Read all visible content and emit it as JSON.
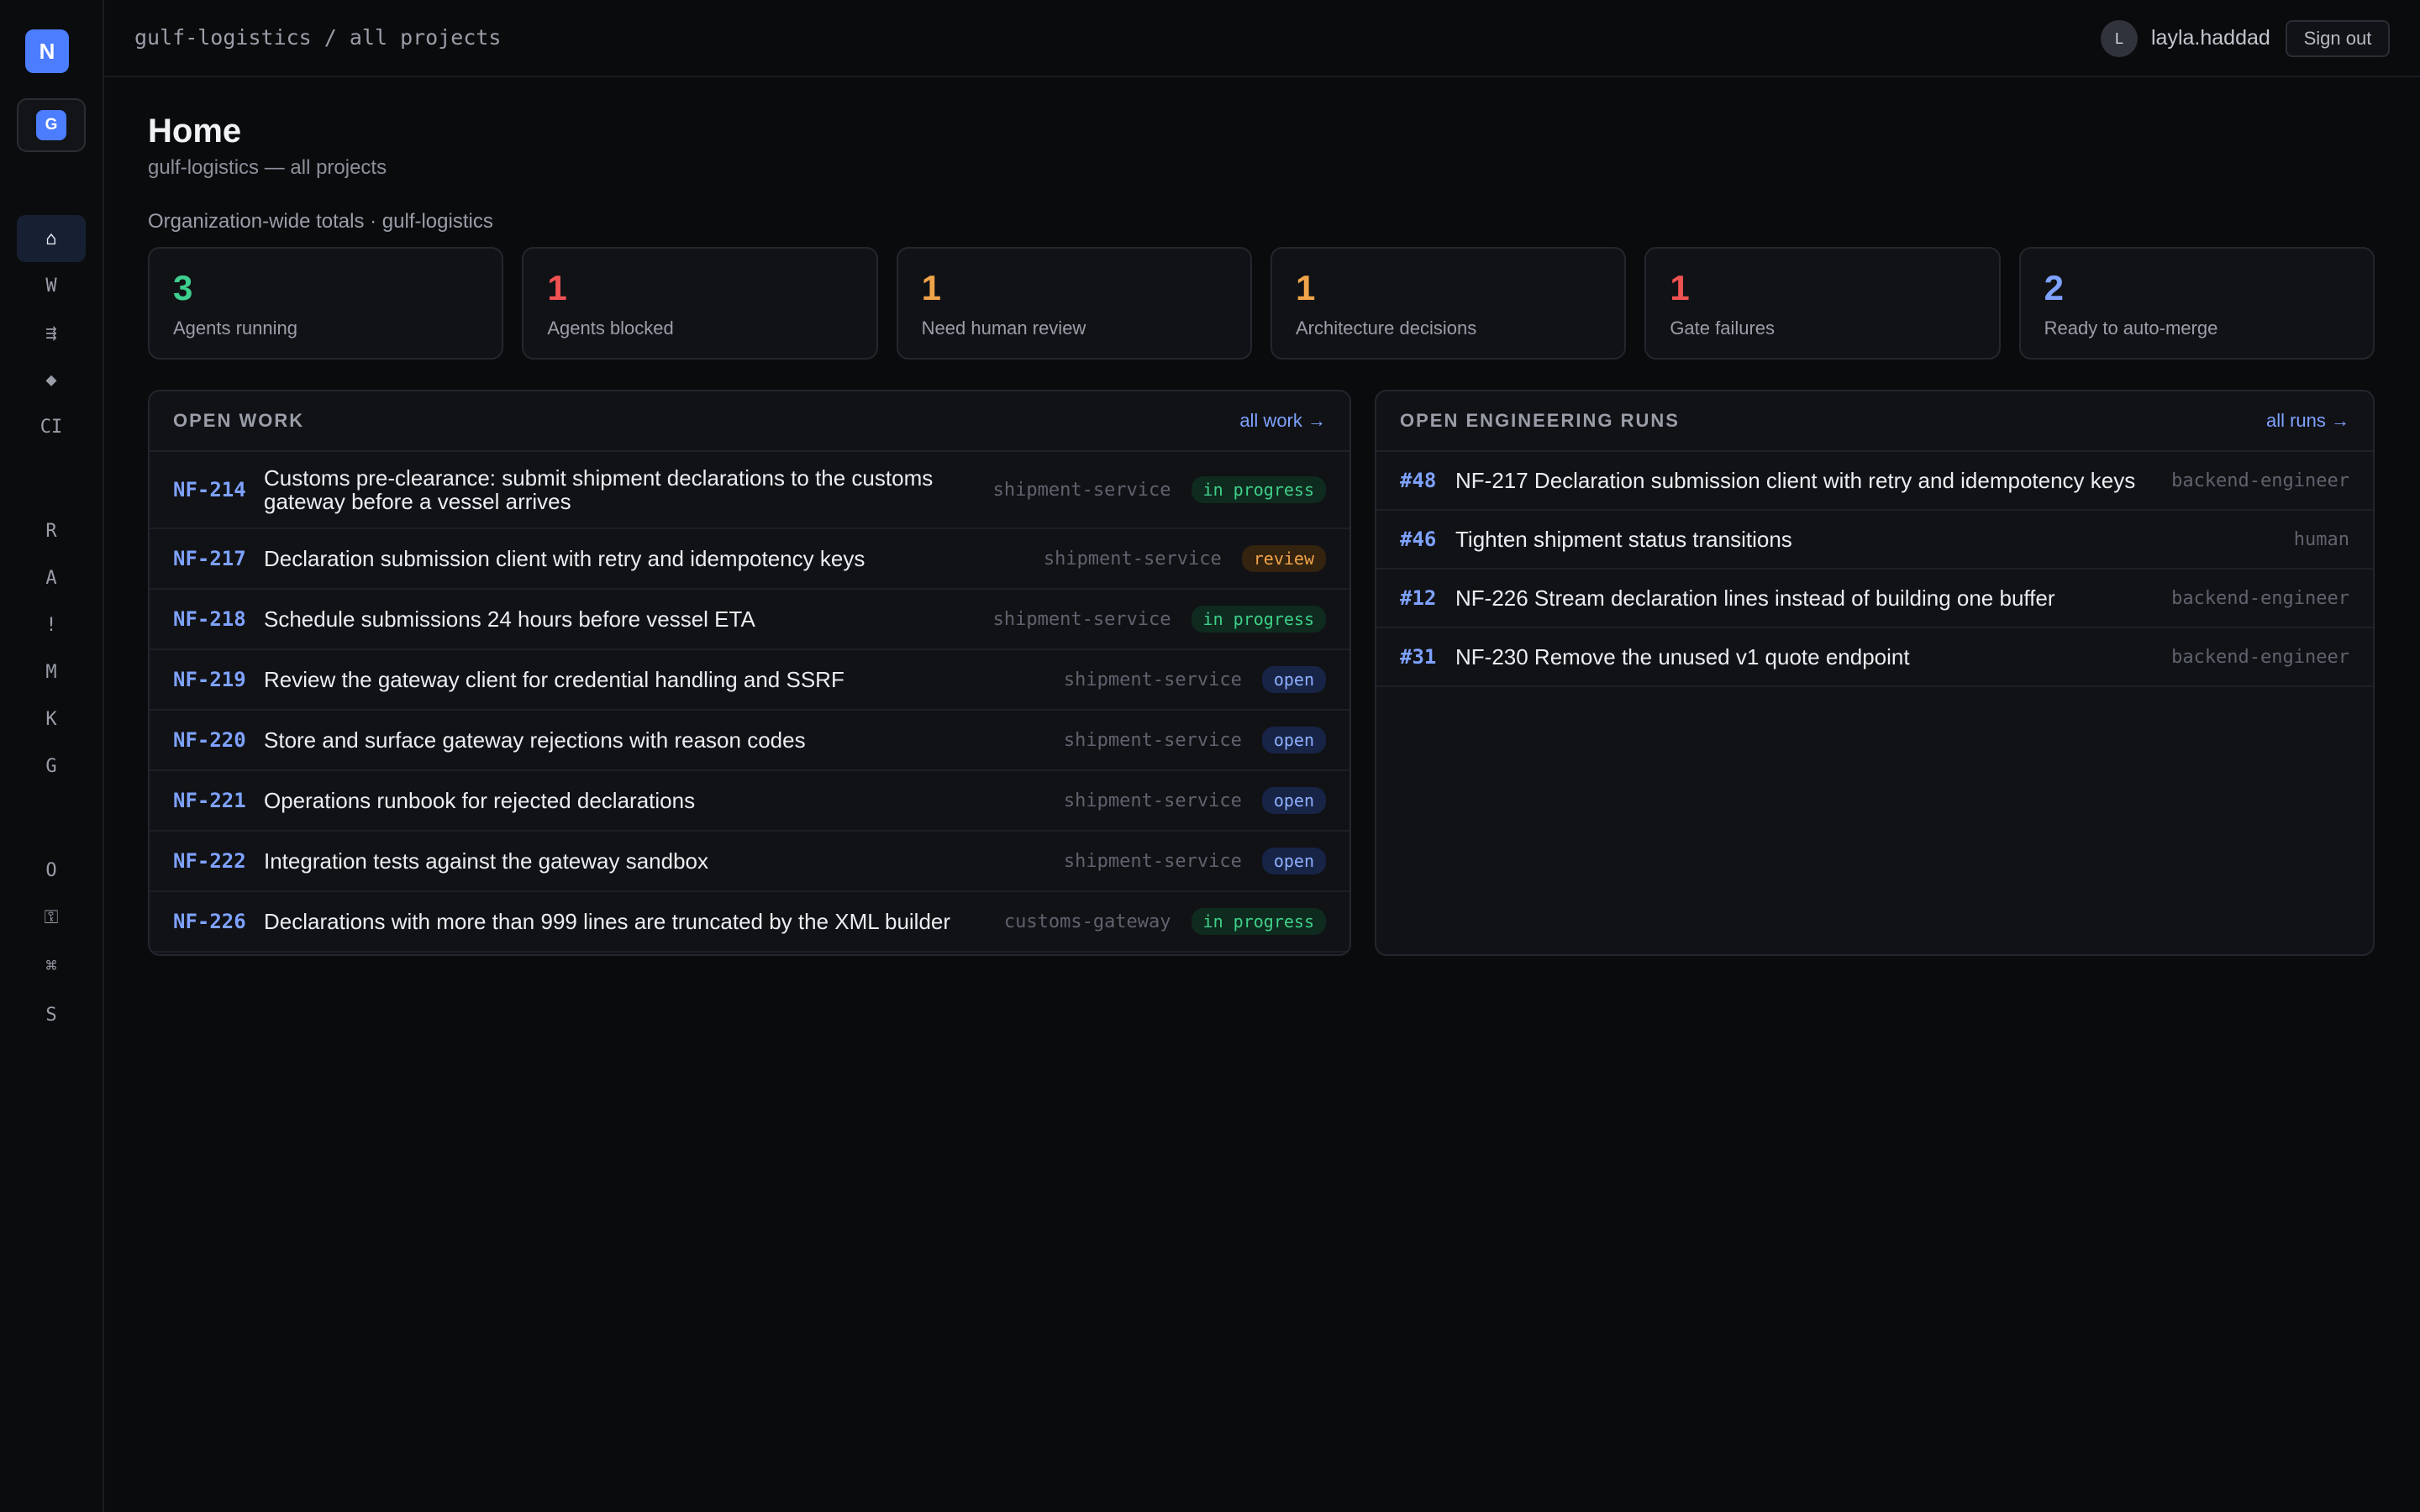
{
  "app": {
    "logo_letter": "N",
    "org_letter": "G"
  },
  "sidebar": {
    "items": [
      {
        "glyph": "⌂",
        "name": "home",
        "active": true
      },
      {
        "glyph": "W",
        "name": "work"
      },
      {
        "glyph": "⇶",
        "name": "runs"
      },
      {
        "glyph": "◆",
        "name": "decisions"
      },
      {
        "glyph": "CI",
        "name": "ci"
      },
      {
        "glyph": "R",
        "name": "r"
      },
      {
        "glyph": "A",
        "name": "a"
      },
      {
        "glyph": "!",
        "name": "alerts"
      },
      {
        "glyph": "M",
        "name": "m"
      },
      {
        "glyph": "K",
        "name": "k"
      },
      {
        "glyph": "G",
        "name": "g"
      },
      {
        "glyph": "O",
        "name": "o"
      },
      {
        "glyph": "⚿",
        "name": "keys"
      },
      {
        "glyph": "⌘",
        "name": "commands"
      },
      {
        "glyph": "S",
        "name": "settings"
      }
    ]
  },
  "topbar": {
    "breadcrumb": "gulf-logistics / all projects",
    "avatar_letter": "L",
    "user_name": "layla.haddad",
    "signout_label": "Sign out"
  },
  "header": {
    "title": "Home",
    "subtitle": "gulf-logistics — all projects",
    "totals_caption": "Organization-wide totals · gulf-logistics"
  },
  "stats": [
    {
      "value": "3",
      "label": "Agents running",
      "color": "#3ecf8e"
    },
    {
      "value": "1",
      "label": "Agents blocked",
      "color": "#f05252"
    },
    {
      "value": "1",
      "label": "Need human review",
      "color": "#f0a44a"
    },
    {
      "value": "1",
      "label": "Architecture decisions",
      "color": "#f0a44a"
    },
    {
      "value": "1",
      "label": "Gate failures",
      "color": "#f05252"
    },
    {
      "value": "2",
      "label": "Ready to auto-merge",
      "color": "#7ea2ff"
    }
  ],
  "open_work": {
    "title": "OPEN WORK",
    "link": "all work →",
    "rows": [
      {
        "id": "NF-214",
        "title": "Customs pre-clearance: submit shipment declarations to the customs gateway before a vessel arrives",
        "service": "shipment-service",
        "status": "in progress",
        "status_kind": "in-progress"
      },
      {
        "id": "NF-217",
        "title": "Declaration submission client with retry and idempotency keys",
        "service": "shipment-service",
        "status": "review",
        "status_kind": "review"
      },
      {
        "id": "NF-218",
        "title": "Schedule submissions 24 hours before vessel ETA",
        "service": "shipment-service",
        "status": "in progress",
        "status_kind": "in-progress"
      },
      {
        "id": "NF-219",
        "title": "Review the gateway client for credential handling and SSRF",
        "service": "shipment-service",
        "status": "open",
        "status_kind": "open"
      },
      {
        "id": "NF-220",
        "title": "Store and surface gateway rejections with reason codes",
        "service": "shipment-service",
        "status": "open",
        "status_kind": "open"
      },
      {
        "id": "NF-221",
        "title": "Operations runbook for rejected declarations",
        "service": "shipment-service",
        "status": "open",
        "status_kind": "open"
      },
      {
        "id": "NF-222",
        "title": "Integration tests against the gateway sandbox",
        "service": "shipment-service",
        "status": "open",
        "status_kind": "open"
      },
      {
        "id": "NF-226",
        "title": "Declarations with more than 999 lines are truncated by the XML builder",
        "service": "customs-gateway",
        "status": "in progress",
        "status_kind": "in-progress"
      }
    ]
  },
  "open_runs": {
    "title": "OPEN ENGINEERING RUNS",
    "link": "all runs →",
    "rows": [
      {
        "id": "#48",
        "title": "NF-217 Declaration submission client with retry and idempotency keys",
        "agent": "backend-engineer"
      },
      {
        "id": "#46",
        "title": "Tighten shipment status transitions",
        "agent": "human"
      },
      {
        "id": "#12",
        "title": "NF-226 Stream declaration lines instead of building one buffer",
        "agent": "backend-engineer"
      },
      {
        "id": "#31",
        "title": "NF-230 Remove the unused v1 quote endpoint",
        "agent": "backend-engineer"
      }
    ]
  }
}
